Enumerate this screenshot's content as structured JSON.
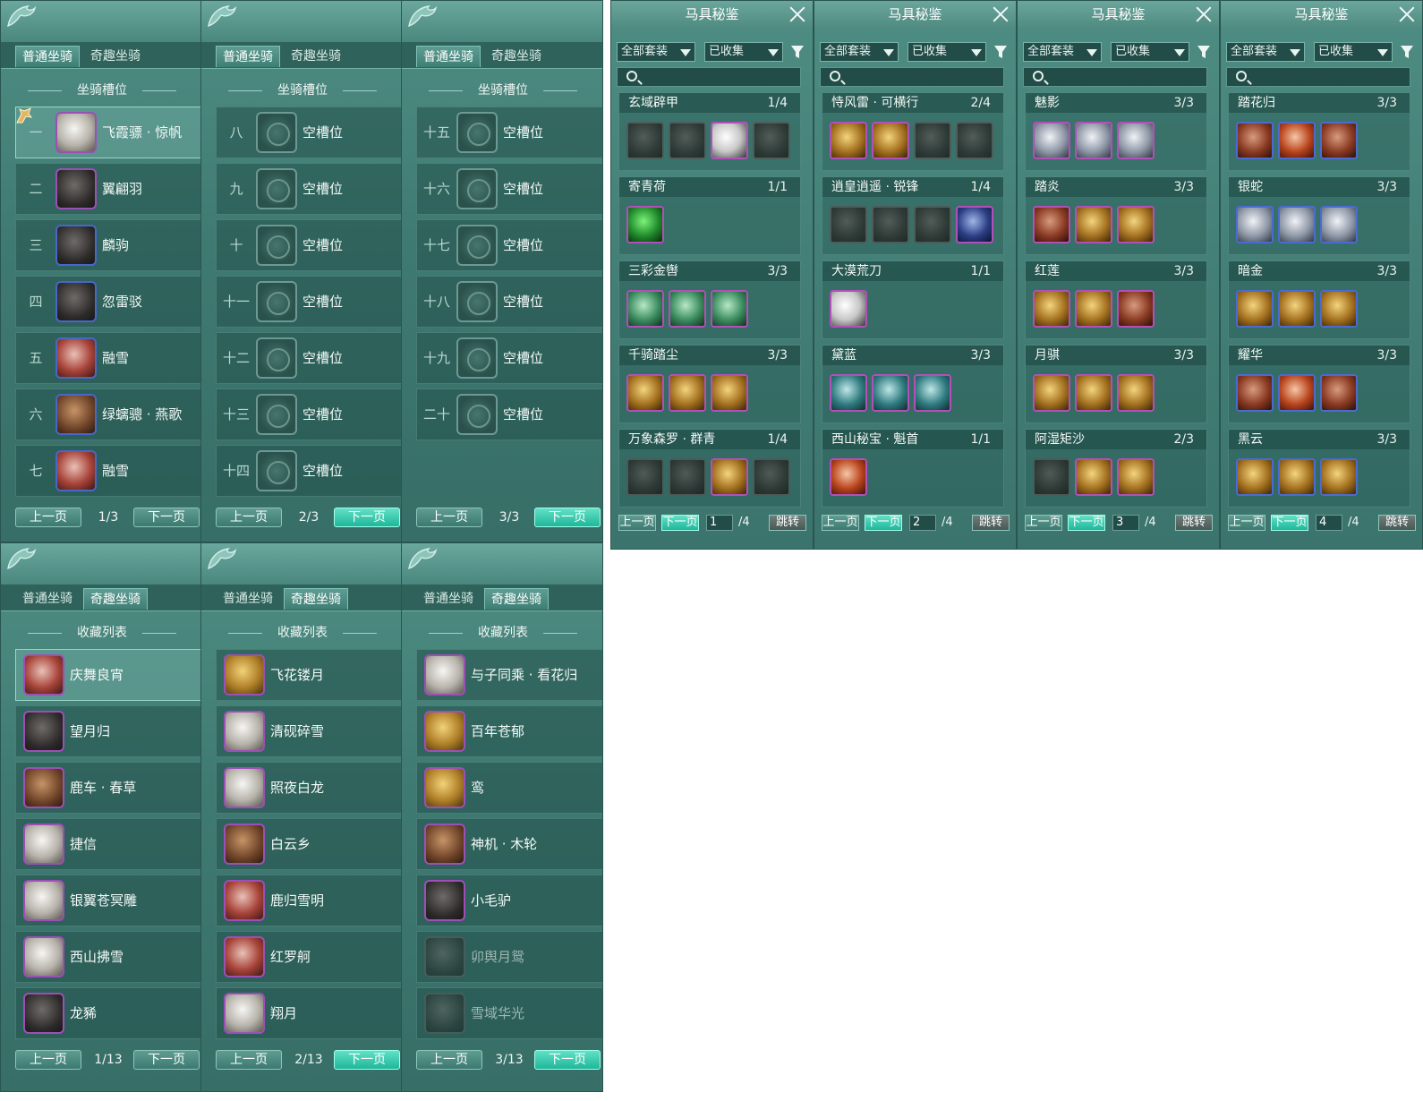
{
  "tabs": {
    "normal": "普通坐骑",
    "fun": "奇趣坐骑"
  },
  "mount_slot_panels": [
    {
      "section_title": "坐骑槽位",
      "page": "1/3",
      "prev": "上一页",
      "next": "下一页",
      "slots": [
        {
          "num": "一",
          "name": "飞霞骠 · 惊帆",
          "icon": "white-horse-icon",
          "tone": "white",
          "frame": "purple"
        },
        {
          "num": "二",
          "name": "翼翩羽",
          "icon": "black-horse-icon",
          "tone": "dark",
          "frame": "purple"
        },
        {
          "num": "三",
          "name": "麟驹",
          "icon": "black-horse-icon",
          "tone": "dark",
          "frame": "blue"
        },
        {
          "num": "四",
          "name": "忽雷驳",
          "icon": "black-horse-icon",
          "tone": "dark",
          "frame": "blue"
        },
        {
          "num": "五",
          "name": "融雪",
          "icon": "white-horse-icon",
          "tone": "red",
          "frame": "blue"
        },
        {
          "num": "六",
          "name": "绿螭骢 · 燕歌",
          "icon": "brown-horse-icon",
          "tone": "brown",
          "frame": "blue"
        },
        {
          "num": "七",
          "name": "融雪",
          "icon": "white-horse-icon",
          "tone": "red",
          "frame": "blue"
        }
      ]
    },
    {
      "section_title": "坐骑槽位",
      "page": "2/3",
      "prev": "上一页",
      "next": "下一页",
      "slots": [
        {
          "num": "八",
          "name": "空槽位"
        },
        {
          "num": "九",
          "name": "空槽位"
        },
        {
          "num": "十",
          "name": "空槽位"
        },
        {
          "num": "十一",
          "name": "空槽位"
        },
        {
          "num": "十二",
          "name": "空槽位"
        },
        {
          "num": "十三",
          "name": "空槽位"
        },
        {
          "num": "十四",
          "name": "空槽位"
        }
      ]
    },
    {
      "section_title": "坐骑槽位",
      "page": "3/3",
      "prev": "上一页",
      "next": "下一页",
      "slots": [
        {
          "num": "十五",
          "name": "空槽位"
        },
        {
          "num": "十六",
          "name": "空槽位"
        },
        {
          "num": "十七",
          "name": "空槽位"
        },
        {
          "num": "十八",
          "name": "空槽位"
        },
        {
          "num": "十九",
          "name": "空槽位"
        },
        {
          "num": "二十",
          "name": "空槽位"
        }
      ]
    }
  ],
  "collection_panels": [
    {
      "section_title": "收藏列表",
      "page": "1/13",
      "prev": "上一页",
      "next": "下一页",
      "items": [
        {
          "name": "庆舞良宵",
          "tone": "red"
        },
        {
          "name": "望月归",
          "tone": "dark"
        },
        {
          "name": "鹿车 · 春草",
          "tone": "brown"
        },
        {
          "name": "捷信",
          "tone": "white"
        },
        {
          "name": "银翼苍冥雕",
          "tone": "white"
        },
        {
          "name": "西山拂雪",
          "tone": "white"
        },
        {
          "name": "龙豨",
          "tone": "dark"
        }
      ]
    },
    {
      "section_title": "收藏列表",
      "page": "2/13",
      "prev": "上一页",
      "next": "下一页",
      "items": [
        {
          "name": "飞花镂月",
          "tone": "gold"
        },
        {
          "name": "清砚碎雪",
          "tone": "white"
        },
        {
          "name": "照夜白龙",
          "tone": "white"
        },
        {
          "name": "白云乡",
          "tone": "brown"
        },
        {
          "name": "鹿归雪明",
          "tone": "red"
        },
        {
          "name": "红罗舸",
          "tone": "red"
        },
        {
          "name": "翔月",
          "tone": "white"
        }
      ]
    },
    {
      "section_title": "收藏列表",
      "page": "3/13",
      "prev": "上一页",
      "next": "下一页",
      "items": [
        {
          "name": "与子同乘 · 看花归",
          "tone": "white"
        },
        {
          "name": "百年苍郁",
          "tone": "gold"
        },
        {
          "name": "鸾",
          "tone": "gold"
        },
        {
          "name": "神机 · 木轮",
          "tone": "brown"
        },
        {
          "name": "小毛驴",
          "tone": "dark"
        },
        {
          "name": "卯舆月鸳",
          "tone": "dark",
          "faded": true
        },
        {
          "name": "雪域华光",
          "tone": "dark",
          "faded": true
        }
      ]
    }
  ],
  "codex_panels": [
    {
      "title": "马具秘鉴",
      "suit_filter": "全部套装",
      "owned_filter": "已收集",
      "page_input": "1",
      "page_total": "/4",
      "prev": "上一页",
      "next": "下一页",
      "jump": "跳转",
      "entries": [
        {
          "name": "玄域辟甲",
          "count": "1/4",
          "items": [
            "c-dark gray",
            "c-dark gray",
            "c-white green",
            "c-dark gray"
          ]
        },
        {
          "name": "寄青荷",
          "count": "1/1",
          "items": [
            "c-green green"
          ]
        },
        {
          "name": "三彩金辔",
          "count": "3/3",
          "items": [
            "c-jade green",
            "c-jade green",
            "c-jade green"
          ]
        },
        {
          "name": "千骑踏尘",
          "count": "3/3",
          "items": [
            "c-gold green",
            "c-gold green",
            "c-gold green"
          ]
        },
        {
          "name": "万象森罗 · 群青",
          "count": "1/4",
          "items": [
            "c-dark gray",
            "c-dark gray",
            "c-gold green",
            "c-dark gray"
          ]
        }
      ]
    },
    {
      "title": "马具秘鉴",
      "suit_filter": "全部套装",
      "owned_filter": "已收集",
      "page_input": "2",
      "page_total": "/4",
      "prev": "上一页",
      "next": "下一页",
      "jump": "跳转",
      "entries": [
        {
          "name": "恃风雷 · 可横行",
          "count": "2/4",
          "items": [
            "c-gold green",
            "c-gold green",
            "c-dark gray",
            "c-dark gray"
          ]
        },
        {
          "name": "逍皇逍遥 · 锐锋",
          "count": "1/4",
          "items": [
            "c-dark gray",
            "c-dark gray",
            "c-dark gray",
            "c-navy green"
          ]
        },
        {
          "name": "大漠荒刀",
          "count": "1/1",
          "items": [
            "c-white green"
          ]
        },
        {
          "name": "黛蓝",
          "count": "3/3",
          "items": [
            "c-teal green",
            "c-teal green",
            "c-teal green"
          ]
        },
        {
          "name": "西山秘宝 · 魁首",
          "count": "1/1",
          "items": [
            "c-orange green"
          ]
        }
      ]
    },
    {
      "title": "马具秘鉴",
      "suit_filter": "全部套装",
      "owned_filter": "已收集",
      "page_input": "3",
      "page_total": "/4",
      "prev": "上一页",
      "next": "下一页",
      "jump": "跳转",
      "entries": [
        {
          "name": "魅影",
          "count": "3/3",
          "items": [
            "c-silver green",
            "c-silver green",
            "c-silver green"
          ]
        },
        {
          "name": "踏炎",
          "count": "3/3",
          "items": [
            "c-red green",
            "c-gold green",
            "c-gold green"
          ]
        },
        {
          "name": "红莲",
          "count": "3/3",
          "items": [
            "c-gold green",
            "c-gold green",
            "c-red green"
          ]
        },
        {
          "name": "月骐",
          "count": "3/3",
          "items": [
            "c-gold green",
            "c-gold green",
            "c-gold green"
          ]
        },
        {
          "name": "阿湿矩沙",
          "count": "2/3",
          "items": [
            "c-dark gray",
            "c-gold green",
            "c-gold green"
          ]
        }
      ]
    },
    {
      "title": "马具秘鉴",
      "suit_filter": "全部套装",
      "owned_filter": "已收集",
      "page_input": "4",
      "page_total": "/4",
      "prev": "上一页",
      "next": "下一页",
      "jump": "跳转",
      "entries": [
        {
          "name": "踏花归",
          "count": "3/3",
          "items": [
            "c-red blue",
            "c-orange blue",
            "c-red blue"
          ]
        },
        {
          "name": "银蛇",
          "count": "3/3",
          "items": [
            "c-silver blue",
            "c-silver blue",
            "c-silver blue"
          ]
        },
        {
          "name": "暗金",
          "count": "3/3",
          "items": [
            "c-gold blue",
            "c-gold blue",
            "c-gold blue"
          ]
        },
        {
          "name": "耀华",
          "count": "3/3",
          "items": [
            "c-red blue",
            "c-orange blue",
            "c-red blue"
          ]
        },
        {
          "name": "黑云",
          "count": "3/3",
          "items": [
            "c-gold blue",
            "c-gold blue",
            "c-gold blue"
          ]
        }
      ]
    }
  ]
}
